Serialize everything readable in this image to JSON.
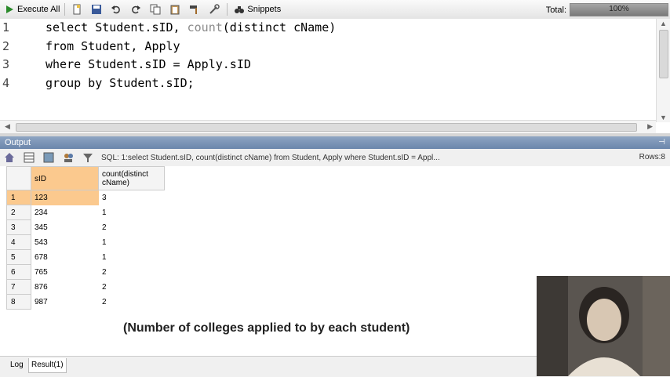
{
  "toolbar": {
    "execute_all": "Execute All",
    "snippets": "Snippets",
    "total_label": "Total:",
    "total_value": "100%",
    "total_fraction": 1.0
  },
  "editor": {
    "line_numbers": [
      "1",
      "2",
      "3",
      "4"
    ],
    "lines": [
      {
        "pre": "select Student.sID, ",
        "fn": "count",
        "post": "(distinct cName)"
      },
      {
        "pre": "from Student, Apply",
        "fn": "",
        "post": ""
      },
      {
        "pre": "where Student.sID = Apply.sID",
        "fn": "",
        "post": ""
      },
      {
        "pre": "group by Student.sID;",
        "fn": "",
        "post": ""
      }
    ]
  },
  "output": {
    "title": "Output",
    "sql_summary": "SQL: 1:select Student.sID, count(distinct cName)  from Student, Apply  where Student.sID = Appl...",
    "rows_label": "Rows:8"
  },
  "grid": {
    "columns": [
      "sID",
      "count(distinct cName)"
    ],
    "rows": [
      {
        "num": "1",
        "sid": "123",
        "count": "3"
      },
      {
        "num": "2",
        "sid": "234",
        "count": "1"
      },
      {
        "num": "3",
        "sid": "345",
        "count": "2"
      },
      {
        "num": "4",
        "sid": "543",
        "count": "1"
      },
      {
        "num": "5",
        "sid": "678",
        "count": "1"
      },
      {
        "num": "6",
        "sid": "765",
        "count": "2"
      },
      {
        "num": "7",
        "sid": "876",
        "count": "2"
      },
      {
        "num": "8",
        "sid": "987",
        "count": "2"
      }
    ]
  },
  "caption": "(Number of colleges applied to by each student)",
  "tabs": [
    "Log",
    "Result(1)"
  ],
  "colors": {
    "selection": "#fbc98e",
    "output_header": "#7891b5"
  }
}
